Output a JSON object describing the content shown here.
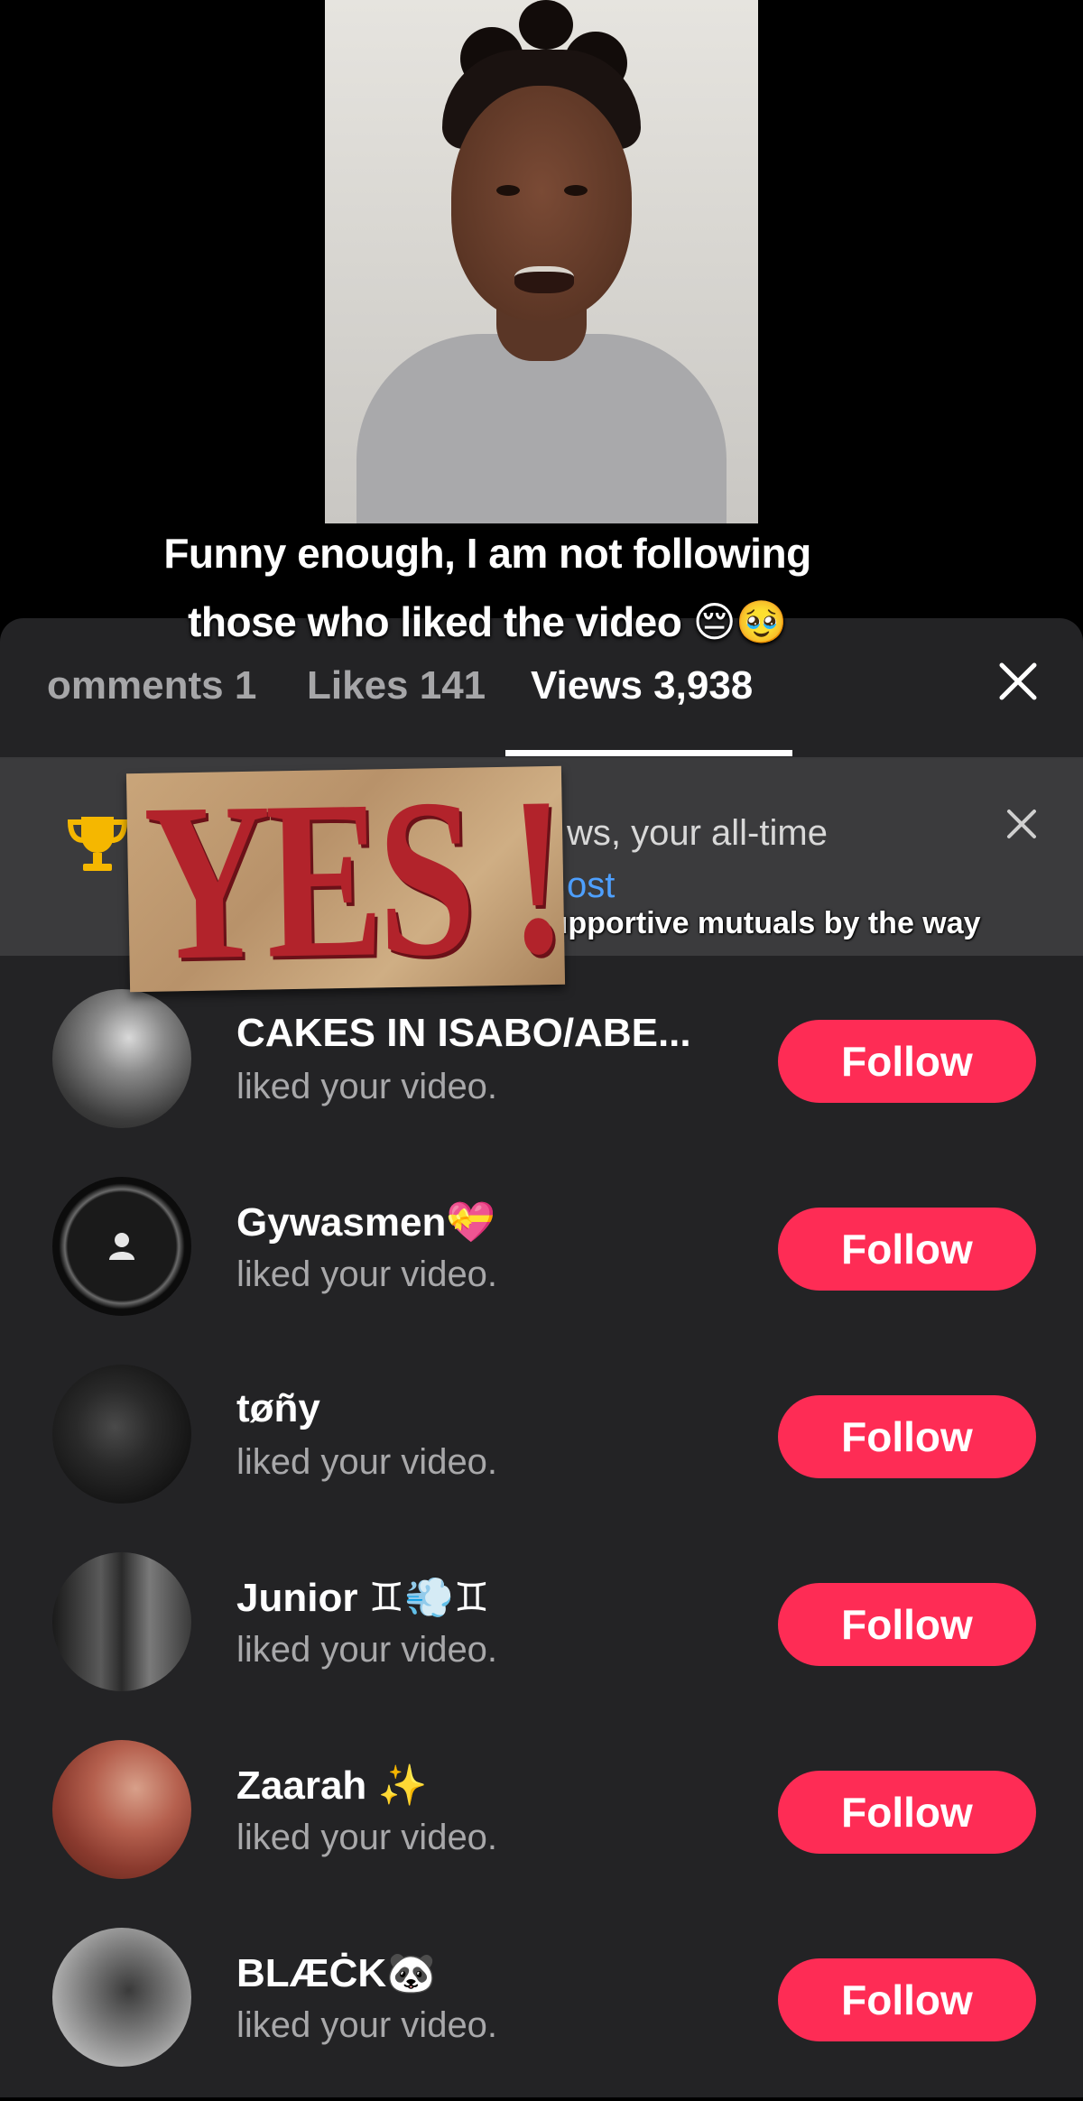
{
  "video": {
    "caption_line1": "Funny enough, I am not following",
    "caption_line2": "those who liked the video 😔🥹"
  },
  "sheet": {
    "tabs": [
      {
        "label": "omments 1"
      },
      {
        "label": "Likes 141"
      },
      {
        "label": "Views 3,938",
        "selected": true
      }
    ],
    "banner": {
      "text_line1": "ws, your all-time",
      "text_line2": "ost",
      "accent_color": "#4ea0ff",
      "icon": "trophy-icon"
    },
    "sticker_text": "YES !",
    "subtitle": "I am tired of unsupportive mutuals by the way",
    "follow_color": "#fe2c55",
    "list": [
      {
        "name": "CAKES IN ISABO/ABE...",
        "action": "liked your video.",
        "button": "Follow"
      },
      {
        "name": "Gywasmen💝",
        "action": "liked your video.",
        "button": "Follow"
      },
      {
        "name": "tøñy",
        "action": "liked your video.",
        "button": "Follow"
      },
      {
        "name": "Junior ♊💨♊",
        "action": "liked your video.",
        "button": "Follow"
      },
      {
        "name": "Zaarah ✨",
        "action": "liked your video.",
        "button": "Follow"
      },
      {
        "name": "BLÆĊK🐼",
        "action": "liked your video.",
        "button": "Follow"
      }
    ]
  }
}
